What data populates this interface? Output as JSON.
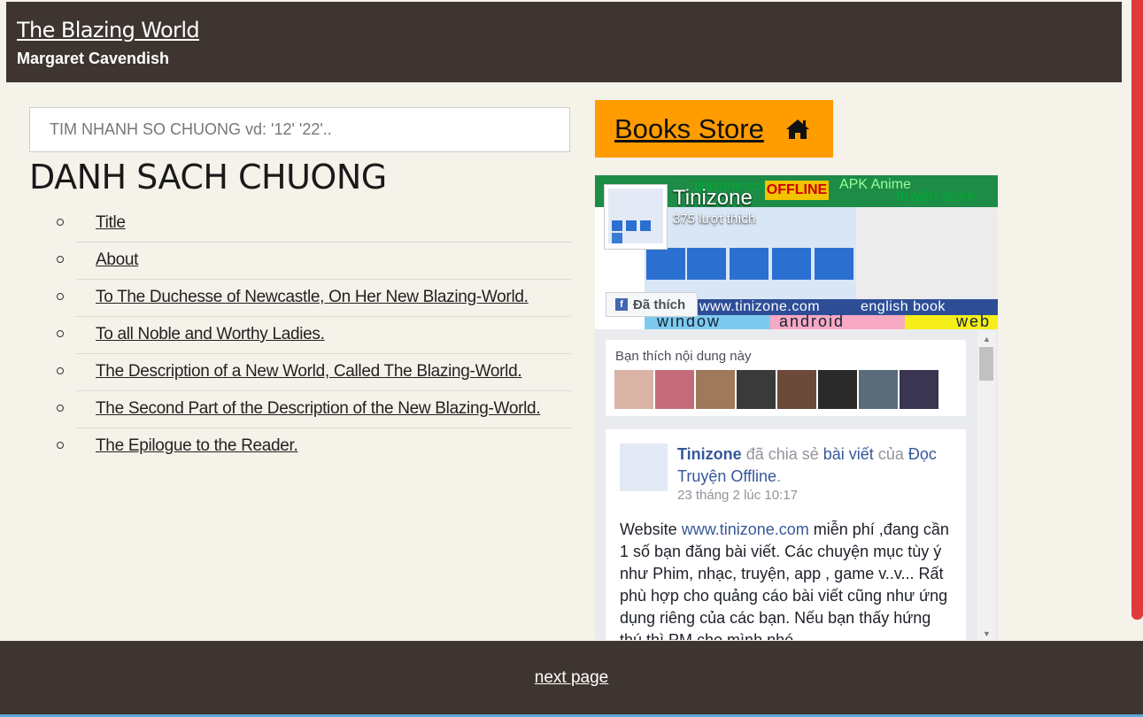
{
  "header": {
    "title": "The Blazing World",
    "author": "Margaret Cavendish"
  },
  "search": {
    "placeholder": "TIM NHANH SO CHUONG vd: '12' '22'.."
  },
  "chapter_list": {
    "heading": "DANH SACH CHUONG",
    "items": [
      {
        "label": "Title"
      },
      {
        "label": "About"
      },
      {
        "label": "To The Duchesse of Newcastle, On Her New Blazing-World."
      },
      {
        "label": "To all Noble and Worthy Ladies."
      },
      {
        "label": "The Description of a New World, Called The Blazing-World."
      },
      {
        "label": "The Second Part of the Description of the New Blazing-World."
      },
      {
        "label": "The Epilogue to the Reader."
      }
    ]
  },
  "store": {
    "label": "Books Store",
    "icon": "home-icon"
  },
  "facebook": {
    "page_name": "Tinizone",
    "likes_text": "375 lượt thích",
    "like_button": "Đã thích",
    "cover": {
      "site": "tinizone.com",
      "offline": "OFFLINE",
      "tags": "APK Anime",
      "store_text": "truyện store",
      "url_text": "www.tinizone.com",
      "english_text": "english book",
      "window": "window",
      "android": "android",
      "web": "web"
    },
    "friends_card": {
      "title": "Bạn thích nội dung này",
      "face_colors": [
        "#d9b3a6",
        "#c36b7a",
        "#a0785a",
        "#3a3a3a",
        "#6b4a3a",
        "#2a2a2a",
        "#5a6b7a",
        "#3a3550"
      ]
    },
    "post": {
      "author": "Tinizone",
      "shared": "đã chia sẻ",
      "shared_link": "bài viết",
      "of": "của",
      "source": "Đọc Truyện Offline",
      "period": ".",
      "time": "23 tháng 2 lúc 10:17",
      "body_start": "Website ",
      "body_link": "www.tinizone.com",
      "body_rest": " miễn phí ,đang cần 1 số bạn đăng bài viết. Các chuyện mục tùy ý như Phim, nhạc, truyện, app , game v..v... Rất phù hợp cho quảng cáo bài viết cũng như ứng dụng riêng của các bạn. Nếu bạn thấy hứng thú thì PM cho mình nhé"
    }
  },
  "footer": {
    "next_label": "next page"
  }
}
